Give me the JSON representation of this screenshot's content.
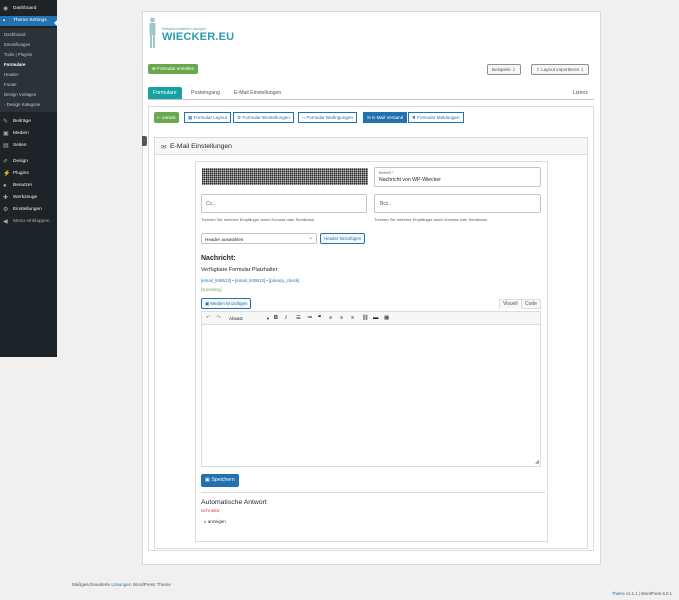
{
  "sidebar": {
    "dashboard": "Dashboard",
    "theme_settings": "Theme Settings",
    "sub_items": [
      "Dashboard",
      "Einstellungen",
      "Tools | Plugins",
      "Formulare",
      "Header",
      "Footer",
      "Design Vorlagen",
      "- Design Kategorie"
    ],
    "items": [
      "Beiträge",
      "Medien",
      "Seiten",
      "Design",
      "Plugins",
      "Benutzer",
      "Werkzeuge",
      "Einstellungen",
      "Menü einklappen"
    ]
  },
  "logo": {
    "small": "Maßgeschneiderte Lösungen",
    "big": "WIECKER.EU"
  },
  "toolbar": {
    "create_form": "Formular erstellen",
    "examples": "Beispiele",
    "import_layout": "Layout importieren"
  },
  "tabs": [
    "Formulare",
    "Posteingang",
    "E-Mail Einstellungen"
  ],
  "license": "Lizenz",
  "subtabs": {
    "back": "zurück",
    "items": [
      "Formular Layout",
      "Formular-Einstellungen",
      "Formular Bedingungen",
      "E-Mail Versand",
      "Formular Meldungen"
    ]
  },
  "section": {
    "title": "E-Mail Einstellungen"
  },
  "form": {
    "subject_label": "Betreff *",
    "subject_value": "Nachricht von WP-Wiecker",
    "cc_placeholder": "Cc..",
    "bcc_placeholder": "Bcc..",
    "cc_hint": "Trennen Sie mehrere Empfänger durch Komma oder Semikolon.",
    "bcc_hint": "Trennen Sie mehrere Empfänger durch Komma oder Semikolon.",
    "header_select": "Header auswählen",
    "header_add": "Header hinzufügen"
  },
  "message": {
    "heading": "Nachricht:",
    "placeholders_label": "Verfügbare Formular Platzhalter:",
    "placeholders": [
      "[email_849513]",
      "[email_849513]",
      "[privacy_check]"
    ],
    "summary": "[summary]",
    "media_button": "Medien hinzufügen",
    "tab_visual": "Visuell",
    "tab_code": "Code",
    "format_select": "Absatz"
  },
  "save_button": "Speichern",
  "auto_reply": {
    "heading": "Automatische Antwort",
    "status": "nicht aktiv",
    "toggle": "anzeigen"
  },
  "footer": {
    "left_prefix": "Maßgeschneiderte ",
    "left_highlight": "Lösungen",
    "left_suffix": " WordPress Theme",
    "right_theme": "Theme",
    "right_theme_version": " v1.1.1",
    "right_wp": " | WordPress 6.0.1"
  },
  "colors": {
    "sidebar_bg": "#1d2327",
    "accent_blue": "#2271b1",
    "accent_green": "#6aa84f",
    "tab_teal": "#17a2a2",
    "status_red": "#d63638"
  }
}
